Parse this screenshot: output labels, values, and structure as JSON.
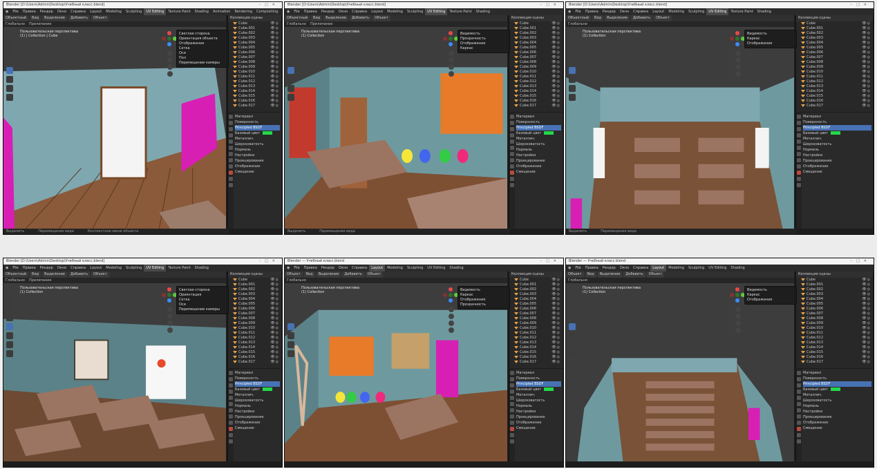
{
  "windows": [
    {
      "title": "Blender [D:\\Users\\Admin\\Desktop\\Учебный класс.blend]",
      "menu": [
        "File",
        "Правка",
        "Рендер",
        "Окно",
        "Справка"
      ],
      "tabs": [
        "Layout",
        "Modeling",
        "Sculpting",
        "UV Editing",
        "Texture Paint",
        "Shading",
        "Animation",
        "Rendering",
        "Compositing"
      ],
      "active_tab": "UV Editing",
      "header": [
        "Объектный",
        "Вид",
        "Выделение",
        "Добавить",
        "Объект"
      ],
      "header2": [
        "Глобально",
        "Прилипание"
      ],
      "viewport_title": [
        "Пользовательская перспектива",
        "(1) | Collection | Cube"
      ],
      "popover": {
        "title": "Светлая сторона",
        "items": [
          "Ориентация объекта",
          "Отображение",
          "Сетка",
          "Оси",
          "Пол",
          "Перемещение камеры"
        ]
      },
      "status": [
        "Выделить",
        "Перемещение вида",
        "Контекстное меню объекта"
      ]
    },
    {
      "title": "Blender [D:\\Users\\Admin\\Desktop\\Учебный класс.blend]",
      "menu": [
        "File",
        "Правка",
        "Рендер",
        "Окно",
        "Справка"
      ],
      "tabs": [
        "Layout",
        "Modeling",
        "Sculpting",
        "UV Editing",
        "Texture Paint",
        "Shading"
      ],
      "active_tab": "UV Editing",
      "header": [
        "Объектный",
        "Вид",
        "Выделение",
        "Добавить",
        "Объект"
      ],
      "header2": [
        "Глобально",
        "Прилипание"
      ],
      "viewport_title": [
        "Пользовательская перспектива",
        "(1) Collection"
      ],
      "popover": {
        "title": "Видимость",
        "items": [
          "Прозрачность",
          "Отображение",
          "Каркас"
        ]
      },
      "status": [
        "Выделить",
        "Перемещение вида"
      ]
    },
    {
      "title": "Blender [D:\\Users\\Admin\\Desktop\\Учебный класс.blend]",
      "menu": [
        "File",
        "Правка",
        "Рендер",
        "Окно",
        "Справка"
      ],
      "tabs": [
        "Layout",
        "Modeling",
        "Sculpting",
        "UV Editing",
        "Texture Paint",
        "Shading"
      ],
      "active_tab": "UV Editing",
      "header": [
        "Объектный",
        "Вид",
        "Выделение",
        "Добавить",
        "Объект"
      ],
      "header2": [
        "Глобально"
      ],
      "viewport_title": [
        "Пользовательская перспектива",
        "(1) Collection"
      ],
      "popover": {
        "title": "Видимость",
        "items": [
          "Каркас",
          "Отображение"
        ]
      },
      "status": [
        "Выделить",
        "Перемещение вида"
      ]
    },
    {
      "title": "Blender [D:\\Users\\Admin\\Desktop\\Учебный класс.blend]",
      "menu": [
        "File",
        "Правка",
        "Рендер",
        "Окно",
        "Справка"
      ],
      "tabs": [
        "Layout",
        "Modeling",
        "Sculpting",
        "UV Editing",
        "Texture Paint",
        "Shading"
      ],
      "active_tab": "UV Editing",
      "header": [
        "Объектный",
        "Вид",
        "Выделение",
        "Добавить",
        "Объект"
      ],
      "header2": [
        "Глобально",
        "Прилипание"
      ],
      "viewport_title": [
        "Пользовательская перспектива",
        "(1) Collection"
      ],
      "popover": {
        "title": "Светлая сторона",
        "items": [
          "Ориентация",
          "Сетка",
          "Оси",
          "Перемещение камеры"
        ]
      },
      "status": []
    },
    {
      "title": "Blender — Учебный класс.blend",
      "menu": [
        "File",
        "Правка",
        "Рендер",
        "Окно",
        "Справка"
      ],
      "tabs": [
        "Layout",
        "Modeling",
        "Sculpting",
        "UV Editing",
        "Shading"
      ],
      "active_tab": "Layout",
      "header": [
        "Объект",
        "Вид",
        "Выделение",
        "Добавить",
        "Объект"
      ],
      "header2": [
        "Глобально"
      ],
      "viewport_title": [
        "Пользовательская перспектива",
        "(1) Collection"
      ],
      "popover": {
        "title": "Видимость",
        "items": [
          "Каркас",
          "Отображение",
          "Прозрачность"
        ]
      },
      "status": []
    },
    {
      "title": "Blender — Учебный класс.blend",
      "menu": [
        "File",
        "Правка",
        "Рендер",
        "Окно",
        "Справка"
      ],
      "tabs": [
        "Layout",
        "Modeling",
        "Sculpting",
        "UV Editing",
        "Shading"
      ],
      "active_tab": "Layout",
      "header": [
        "Объект",
        "Вид",
        "Выделение",
        "Добавить",
        "Объект"
      ],
      "header2": [
        "Глобально"
      ],
      "viewport_title": [
        "Пользовательская перспектива",
        "(1) Collection"
      ],
      "popover": {
        "title": "Видимость",
        "items": [
          "Каркас",
          "Отображение"
        ]
      },
      "status": []
    }
  ],
  "outliner": {
    "header": "Коллекция сцены",
    "items": [
      "Cube",
      "Cube.001",
      "Cube.002",
      "Cube.003",
      "Cube.004",
      "Cube.005",
      "Cube.006",
      "Cube.007",
      "Cube.008",
      "Cube.009",
      "Cube.010",
      "Cube.011",
      "Cube.012",
      "Cube.013",
      "Cube.014",
      "Cube.015",
      "Cube.016",
      "Cube.017"
    ]
  },
  "properties": {
    "rows": [
      "Материал",
      "Поверхность",
      "Principled BSDF",
      "Базовый цвет",
      "Металлич.",
      "Шероховатость",
      "Нормаль",
      "Настройки",
      "Проецирование",
      "Отображение",
      "Смещение"
    ],
    "selected": 2,
    "base_color": "#23d84a"
  }
}
